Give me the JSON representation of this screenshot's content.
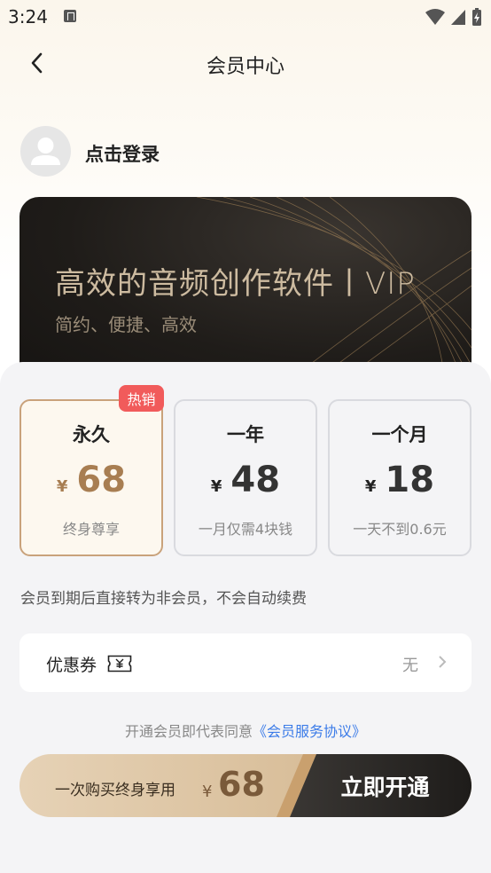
{
  "status_bar": {
    "time": "3:24"
  },
  "header": {
    "title": "会员中心"
  },
  "user": {
    "login_label": "点击登录"
  },
  "banner": {
    "title": "高效的音频创作软件丨VIP",
    "subtitle": "简约、便捷、高效"
  },
  "plans": [
    {
      "name": "永久",
      "currency": "¥",
      "price": "68",
      "desc": "终身尊享",
      "selected": true,
      "badge": "热销"
    },
    {
      "name": "一年",
      "currency": "¥",
      "price": "48",
      "desc": "一月仅需4块钱",
      "selected": false
    },
    {
      "name": "一个月",
      "currency": "¥",
      "price": "18",
      "desc": "一天不到0.6元",
      "selected": false
    }
  ],
  "notice": "会员到期后直接转为非会员，不会自动续费",
  "coupon": {
    "label": "优惠券",
    "value": "无"
  },
  "agreement": {
    "text": "开通会员即代表同意",
    "link": "《会员服务协议》"
  },
  "purchase": {
    "text": "一次购买终身享用",
    "currency": "¥",
    "price": "68",
    "button": "立即开通"
  },
  "colors": {
    "accent_gold": "#a87e52",
    "badge_red": "#f15b5b",
    "link_blue": "#3b7be8"
  }
}
